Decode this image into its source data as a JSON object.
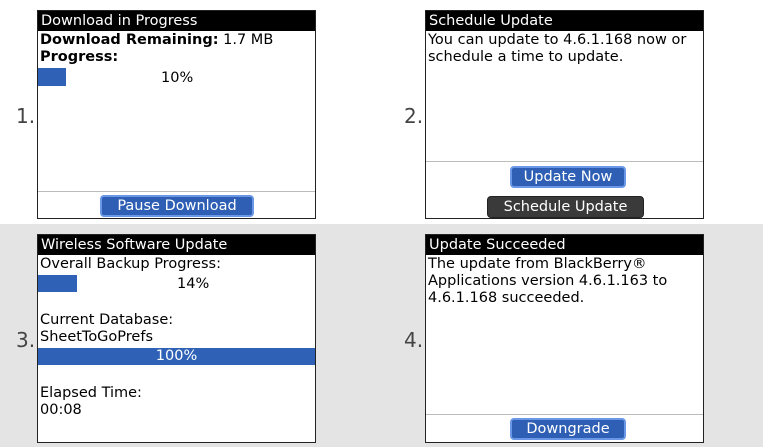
{
  "steps": [
    {
      "number": "1.",
      "title": "Download in Progress",
      "remaining_label": "Download Remaining:",
      "remaining_value": "1.7 MB",
      "progress_label": "Progress:",
      "progress_percent": "10%",
      "progress_fraction": 0.1,
      "button_label": "Pause Download"
    },
    {
      "number": "2.",
      "title": "Schedule Update",
      "message": "You can update to 4.6.1.168 now or schedule a time to update.",
      "primary_button_label": "Update Now",
      "secondary_button_label": "Schedule Update"
    },
    {
      "number": "3.",
      "title": "Wireless Software Update",
      "backup_label": "Overall Backup Progress:",
      "backup_percent": "14%",
      "backup_fraction": 0.14,
      "database_label": "Current Database:",
      "database_value": "SheetToGoPrefs",
      "database_percent": "100%",
      "elapsed_label": "Elapsed Time:",
      "elapsed_value": "00:08"
    },
    {
      "number": "4.",
      "title": "Update Succeeded",
      "message": "The update from BlackBerry® Applications version 4.6.1.163 to 4.6.1.168 succeeded.",
      "button_label": "Downgrade"
    }
  ],
  "colors": {
    "progress_blue": "#2f62b7",
    "title_bar": "#000000",
    "bottom_row_background": "#e4e4e4"
  }
}
